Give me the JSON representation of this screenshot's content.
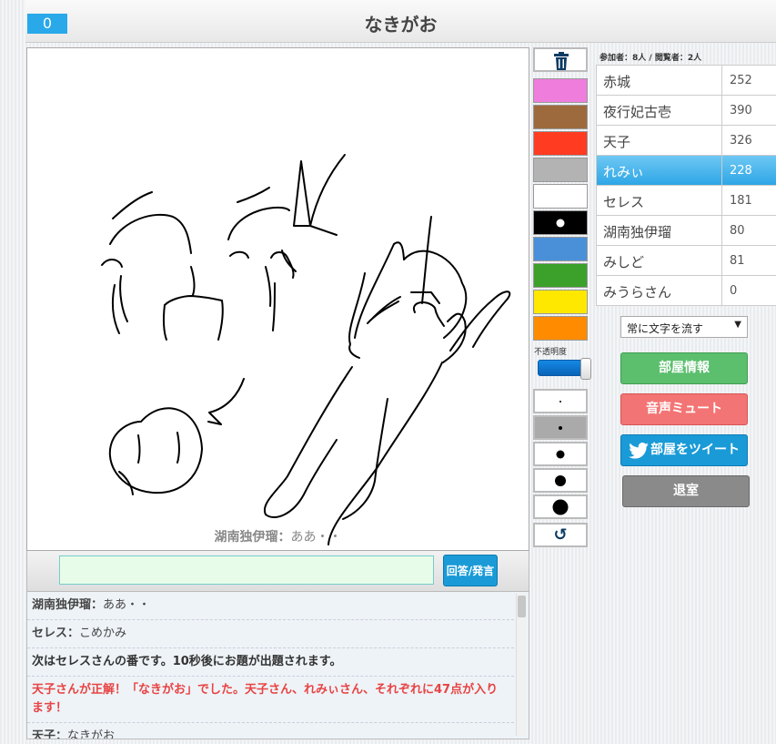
{
  "header": {
    "timer": "0",
    "title": "なきがお"
  },
  "canvas": {
    "status_name": "湖南独伊瑠",
    "status_sep": "：",
    "status_text": "ああ・・"
  },
  "answer": {
    "button_label": "回答/発言"
  },
  "chat": [
    {
      "who": "湖南独伊瑠",
      "sep": "：",
      "text": "ああ・・"
    },
    {
      "who": "セレス",
      "sep": "：",
      "text": "こめかみ"
    },
    {
      "text": "次はセレスさんの番です。10秒後にお題が出題されます。"
    },
    {
      "text": "天子さんが正解！「なきがお」でした。天子さん、れみぃさん、それぞれに47点が入ります！"
    },
    {
      "who": "天子",
      "sep": "：",
      "text": "なきがお"
    }
  ],
  "tools": {
    "colors": [
      "#ee7ddb",
      "#9d6a3e",
      "#ff3b22",
      "#b3b3b3",
      "#ffffff",
      "#000000",
      "#4a90d9",
      "#3ba12a",
      "#ffe800",
      "#ff8c00"
    ],
    "selected_color": "#000000",
    "opacity_label": "不透明度",
    "opacity_value": 1.0
  },
  "room": {
    "counts": "参加者：8人 / 閲覧者：2人",
    "players": [
      {
        "name": "赤城",
        "score": "252"
      },
      {
        "name": "夜行妃古壱",
        "score": "390"
      },
      {
        "name": "天子",
        "score": "326"
      },
      {
        "name": "れみぃ",
        "score": "228"
      },
      {
        "name": "セレス",
        "score": "181"
      },
      {
        "name": "湖南独伊瑠",
        "score": "80"
      },
      {
        "name": "みしど",
        "score": "81"
      },
      {
        "name": "みうらさん",
        "score": "0"
      }
    ],
    "active_player": "れみぃ",
    "flow_option": "常に文字を流す",
    "buttons": {
      "room_info": "部屋情報",
      "mute": "音声ミュート",
      "tweet": "部屋をツイート",
      "leave": "退室"
    }
  },
  "icons": [
    "trash-icon",
    "undo-icon",
    "twitter-bird-icon",
    "dropdown-arrow-icon"
  ]
}
